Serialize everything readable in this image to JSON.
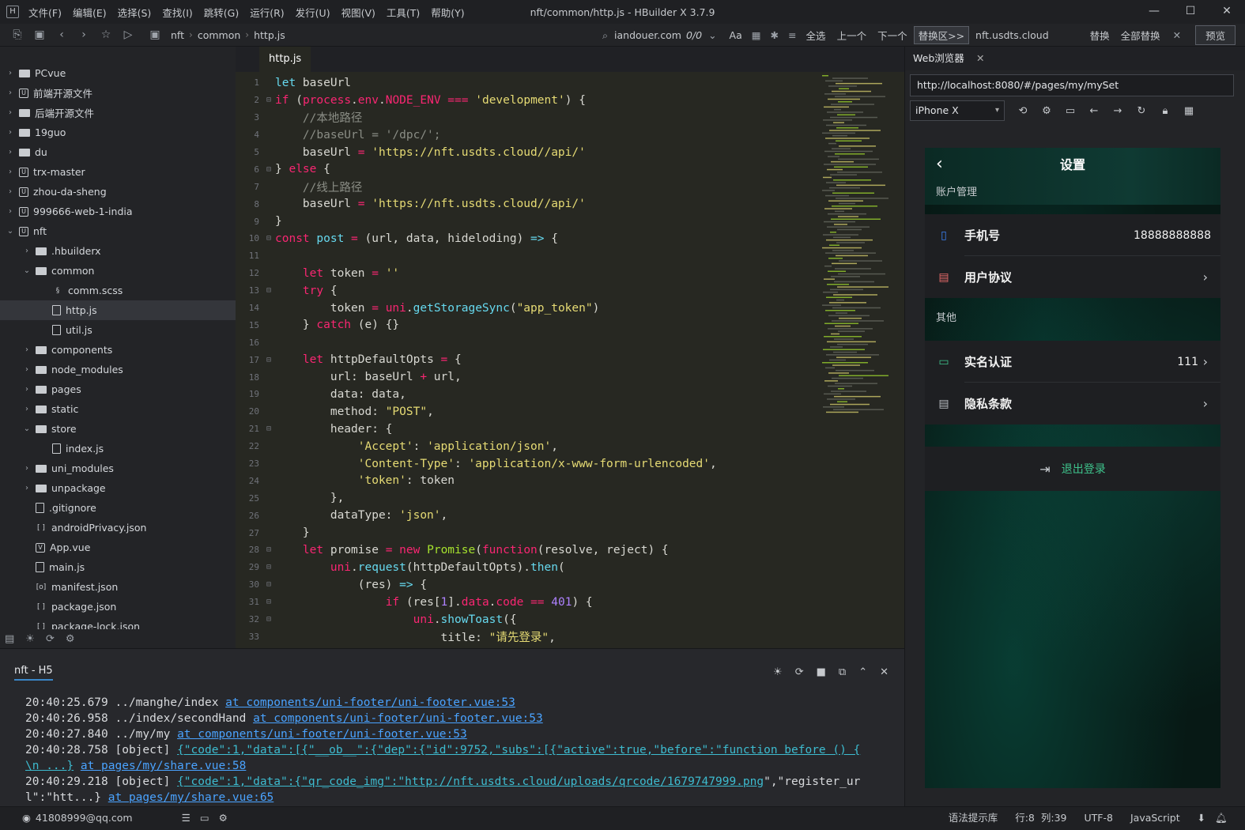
{
  "window": {
    "title": "nft/common/http.js - HBuilder X 3.7.9",
    "icon": "H"
  },
  "menu": [
    "文件(F)",
    "编辑(E)",
    "选择(S)",
    "查找(I)",
    "跳转(G)",
    "运行(R)",
    "发行(U)",
    "视图(V)",
    "工具(T)",
    "帮助(Y)"
  ],
  "breadcrumb": [
    "nft",
    "common",
    "http.js"
  ],
  "find": {
    "query": "iandouer.com",
    "count": "0/0",
    "select_all": "全选",
    "prev": "上一个",
    "next": "下一个",
    "replace_area": "替换区>>",
    "replace_value": "nft.usdts.cloud",
    "replace": "替换",
    "replace_all": "全部替换",
    "preview": "预览",
    "case_icon": "Aa"
  },
  "tree": [
    {
      "label": "PCvue",
      "depth": 0,
      "arrow": "›",
      "icon": "folder"
    },
    {
      "label": "前端开源文件",
      "depth": 0,
      "arrow": "›",
      "icon": "hb"
    },
    {
      "label": "后端开源文件",
      "depth": 0,
      "arrow": "›",
      "icon": "folder"
    },
    {
      "label": "19guo",
      "depth": 0,
      "arrow": "›",
      "icon": "folder"
    },
    {
      "label": "du",
      "depth": 0,
      "arrow": "›",
      "icon": "folder"
    },
    {
      "label": "trx-master",
      "depth": 0,
      "arrow": "›",
      "icon": "hb"
    },
    {
      "label": "zhou-da-sheng",
      "depth": 0,
      "arrow": "›",
      "icon": "hb"
    },
    {
      "label": "999666-web-1-india",
      "depth": 0,
      "arrow": "›",
      "icon": "hb"
    },
    {
      "label": "nft",
      "depth": 0,
      "arrow": "⌄",
      "icon": "hb"
    },
    {
      "label": ".hbuilderx",
      "depth": 1,
      "arrow": "›",
      "icon": "folder"
    },
    {
      "label": "common",
      "depth": 1,
      "arrow": "⌄",
      "icon": "folder"
    },
    {
      "label": "comm.scss",
      "depth": 2,
      "arrow": "",
      "icon": "scss"
    },
    {
      "label": "http.js",
      "depth": 2,
      "arrow": "",
      "icon": "file",
      "selected": true
    },
    {
      "label": "util.js",
      "depth": 2,
      "arrow": "",
      "icon": "file"
    },
    {
      "label": "components",
      "depth": 1,
      "arrow": "›",
      "icon": "folder"
    },
    {
      "label": "node_modules",
      "depth": 1,
      "arrow": "›",
      "icon": "folder"
    },
    {
      "label": "pages",
      "depth": 1,
      "arrow": "›",
      "icon": "folder"
    },
    {
      "label": "static",
      "depth": 1,
      "arrow": "›",
      "icon": "folder"
    },
    {
      "label": "store",
      "depth": 1,
      "arrow": "⌄",
      "icon": "folder"
    },
    {
      "label": "index.js",
      "depth": 2,
      "arrow": "",
      "icon": "file"
    },
    {
      "label": "uni_modules",
      "depth": 1,
      "arrow": "›",
      "icon": "folder"
    },
    {
      "label": "unpackage",
      "depth": 1,
      "arrow": "›",
      "icon": "folder"
    },
    {
      "label": ".gitignore",
      "depth": 1,
      "arrow": "",
      "icon": "file"
    },
    {
      "label": "androidPrivacy.json",
      "depth": 1,
      "arrow": "",
      "icon": "json"
    },
    {
      "label": "App.vue",
      "depth": 1,
      "arrow": "",
      "icon": "vue"
    },
    {
      "label": "main.js",
      "depth": 1,
      "arrow": "",
      "icon": "file"
    },
    {
      "label": "manifest.json",
      "depth": 1,
      "arrow": "",
      "icon": "manifest"
    },
    {
      "label": "package.json",
      "depth": 1,
      "arrow": "",
      "icon": "json"
    },
    {
      "label": "package-lock.json",
      "depth": 1,
      "arrow": "",
      "icon": "json"
    }
  ],
  "editor": {
    "tab": "http.js",
    "lines": [
      {
        "n": 1,
        "f": "",
        "h": "<span class='kw2'>let</span> baseUrl"
      },
      {
        "n": 2,
        "f": "⊟",
        "h": "<span class='kw'>if</span> (<span class='kw'>process</span>.<span class='kw'>env</span>.<span class='kw'>NODE_ENV</span> <span class='kw'>===</span> <span class='str'>'development'</span>) {"
      },
      {
        "n": 3,
        "f": "",
        "h": "    <span class='cm'>//本地路径</span>"
      },
      {
        "n": 4,
        "f": "",
        "h": "    <span class='cm'>//baseUrl = '/dpc/';</span>"
      },
      {
        "n": 5,
        "f": "",
        "h": "    baseUrl <span class='kw'>=</span> <span class='str'>'https://nft.usdts.cloud//api/'</span>"
      },
      {
        "n": 6,
        "f": "⊟",
        "h": "} <span class='kw'>else</span> {"
      },
      {
        "n": 7,
        "f": "",
        "h": "    <span class='cm'>//线上路径</span>"
      },
      {
        "n": 8,
        "f": "",
        "h": "    baseUrl <span class='kw'>=</span> <span class='str'>'https://nft.usdts.cloud//api/'</span>"
      },
      {
        "n": 9,
        "f": "",
        "h": "}"
      },
      {
        "n": 10,
        "f": "⊟",
        "h": "<span class='kw'>const</span> <span class='kw2'>post</span> <span class='kw'>=</span> (url, data, hideloding) <span class='kw2'>=&gt;</span> {"
      },
      {
        "n": 11,
        "f": "",
        "h": ""
      },
      {
        "n": 12,
        "f": "",
        "h": "    <span class='kw'>let</span> token <span class='kw'>=</span> <span class='str'>''</span>"
      },
      {
        "n": 13,
        "f": "⊟",
        "h": "    <span class='kw'>try</span> {"
      },
      {
        "n": 14,
        "f": "",
        "h": "        token <span class='kw'>=</span> <span class='kw'>uni</span>.<span class='kw2'>getStorageSync</span>(<span class='str'>\"app_token\"</span>)"
      },
      {
        "n": 15,
        "f": "",
        "h": "    } <span class='kw'>catch</span> (e) {}"
      },
      {
        "n": 16,
        "f": "",
        "h": ""
      },
      {
        "n": 17,
        "f": "⊟",
        "h": "    <span class='kw'>let</span> httpDefaultOpts <span class='kw'>=</span> {"
      },
      {
        "n": 18,
        "f": "",
        "h": "        url: baseUrl <span class='kw'>+</span> url,"
      },
      {
        "n": 19,
        "f": "",
        "h": "        data: data,"
      },
      {
        "n": 20,
        "f": "",
        "h": "        method: <span class='str'>\"POST\"</span>,"
      },
      {
        "n": 21,
        "f": "⊟",
        "h": "        header: {"
      },
      {
        "n": 22,
        "f": "",
        "h": "            <span class='str'>'Accept'</span>: <span class='str'>'application/json'</span>,"
      },
      {
        "n": 23,
        "f": "",
        "h": "            <span class='str'>'Content-Type'</span>: <span class='str'>'application/x-www-form-urlencoded'</span>,"
      },
      {
        "n": 24,
        "f": "",
        "h": "            <span class='str'>'token'</span>: token"
      },
      {
        "n": 25,
        "f": "",
        "h": "        },"
      },
      {
        "n": 26,
        "f": "",
        "h": "        dataType: <span class='str'>'json'</span>,"
      },
      {
        "n": 27,
        "f": "",
        "h": "    }"
      },
      {
        "n": 28,
        "f": "⊟",
        "h": "    <span class='kw'>let</span> promise <span class='kw'>=</span> <span class='kw'>new</span> <span class='fn'>Promise</span>(<span class='kw'>function</span>(resolve, reject) {"
      },
      {
        "n": 29,
        "f": "⊟",
        "h": "        <span class='kw'>uni</span>.<span class='kw2'>request</span>(httpDefaultOpts).<span class='kw2'>then</span>("
      },
      {
        "n": 30,
        "f": "⊟",
        "h": "            (res) <span class='kw2'>=&gt;</span> {"
      },
      {
        "n": 31,
        "f": "⊟",
        "h": "                <span class='kw'>if</span> (res[<span class='num'>1</span>].<span class='kw'>data</span>.<span class='kw'>code</span> <span class='kw'>==</span> <span class='num'>401</span>) {"
      },
      {
        "n": 32,
        "f": "⊟",
        "h": "                    <span class='kw'>uni</span>.<span class='kw2'>showToast</span>({"
      },
      {
        "n": 33,
        "f": "",
        "h": "                        title: <span class='str'>\"请先登录\"</span>,"
      }
    ]
  },
  "browser": {
    "tab": "Web浏览器",
    "url": "http://localhost:8080/#/pages/my/mySet",
    "device": "iPhone X"
  },
  "phone": {
    "title": "设置",
    "section_account": "账户管理",
    "phone_label": "手机号",
    "phone_value": "18888888888",
    "agreement_label": "用户协议",
    "section_other": "其他",
    "realname_label": "实名认证",
    "realname_value": "111",
    "privacy_label": "隐私条款",
    "logout": "退出登录",
    "accent": "#3ec38c"
  },
  "console": {
    "tab": "nft - H5",
    "lines": [
      {
        "h": "20:40:25.679 ../manghe/index  <span class='lnk'>at components/uni-footer/uni-footer.vue:53</span>"
      },
      {
        "h": "20:40:26.958 ../index/secondHand  <span class='lnk'>at components/uni-footer/uni-footer.vue:53</span>"
      },
      {
        "h": "20:40:27.840 ../my/my  <span class='lnk'>at components/uni-footer/uni-footer.vue:53</span>"
      },
      {
        "h": "20:40:28.758 [object] <span class='lnk2'>{\"code\":1,\"data\":[{\"__ob__\":{\"dep\":{\"id\":9752,\"subs\":[{\"active\":true,\"before\":\"function before () {</span>"
      },
      {
        "h": "<span class='lnk2'>\\n        ...}</span>   <span class='lnk'>at pages/my/share.vue:58</span>"
      },
      {
        "h": "20:40:29.218 [object] <span class='lnk2'>{\"code\":1,\"data\":{\"qr_code_img\":\"http://nft.usdts.cloud/uploads/qrcode/1679747999.png</span>\",\"register_ur"
      },
      {
        "h": "l\":\"htt...}   <span class='lnk'>at pages/my/share.vue:65</span>"
      }
    ]
  },
  "status": {
    "user": "41808999@qq.com",
    "syntax": "语法提示库",
    "line": "行:8",
    "col": "列:39",
    "encoding": "UTF-8",
    "language": "JavaScript"
  }
}
